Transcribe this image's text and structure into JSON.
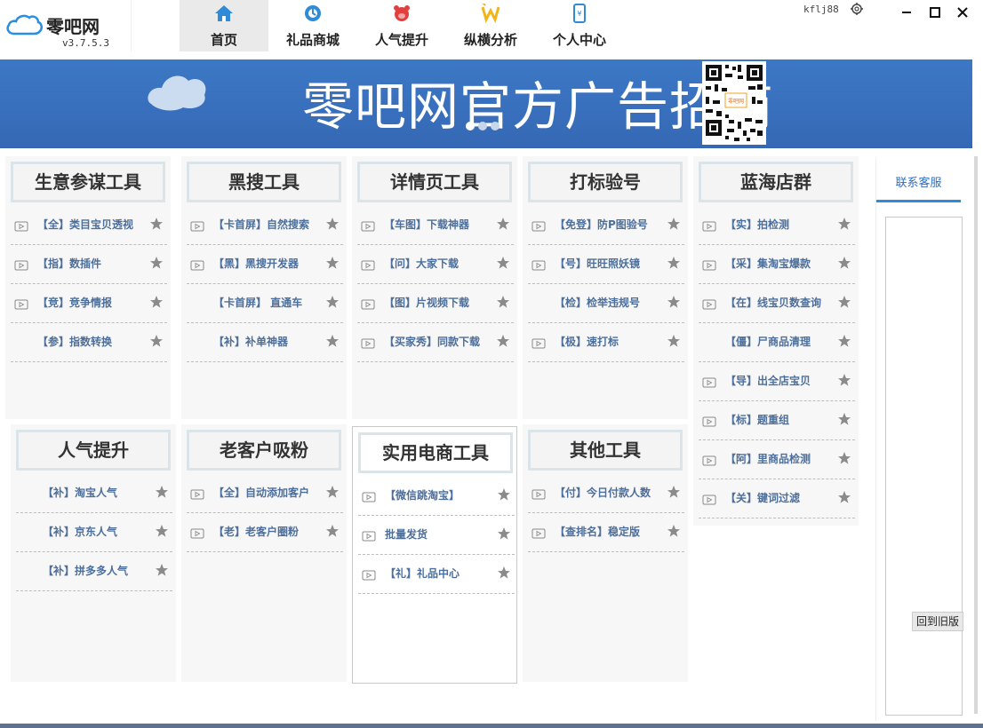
{
  "app": {
    "title": "零吧网",
    "version": "v3.7.5.3",
    "user": "kflj88"
  },
  "nav": [
    {
      "label": "首页",
      "icon": "home-icon",
      "active": true
    },
    {
      "label": "礼品商城",
      "icon": "gift-mall-icon",
      "active": false
    },
    {
      "label": "人气提升",
      "icon": "pig-icon",
      "active": false
    },
    {
      "label": "纵横分析",
      "icon": "analysis-icon",
      "active": false
    },
    {
      "label": "个人中心",
      "icon": "phone-icon",
      "active": false
    }
  ],
  "banner": {
    "text": "零吧网官方广告招商",
    "qr_label": "零吧网"
  },
  "cards": [
    {
      "title": "生意参谋工具",
      "rows": [
        {
          "label": "【全】类目宝贝透视",
          "icon": true
        },
        {
          "label": "【指】数插件",
          "icon": true
        },
        {
          "label": "【竞】竞争情报",
          "icon": true
        },
        {
          "label": "【参】指数转换",
          "icon": false
        }
      ]
    },
    {
      "title": "黑搜工具",
      "rows": [
        {
          "label": "【卡首屏】自然搜索",
          "icon": true
        },
        {
          "label": "【黑】黑搜开发器",
          "icon": true
        },
        {
          "label": "【卡首屏】 直通车",
          "icon": false
        },
        {
          "label": "【补】补单神器",
          "icon": false
        }
      ]
    },
    {
      "title": "详情页工具",
      "rows": [
        {
          "label": "【车图】下载神器",
          "icon": true
        },
        {
          "label": "【问】大家下载",
          "icon": true
        },
        {
          "label": "【图】片视频下载",
          "icon": true
        },
        {
          "label": "【买家秀】同款下载",
          "icon": true
        }
      ]
    },
    {
      "title": "打标验号",
      "rows": [
        {
          "label": "【免登】防P图验号",
          "icon": true
        },
        {
          "label": "【号】旺旺照妖镜",
          "icon": true
        },
        {
          "label": "【检】检举违规号",
          "icon": false
        },
        {
          "label": "【极】速打标",
          "icon": true
        }
      ]
    },
    {
      "title": "蓝海店群",
      "rows": [
        {
          "label": "【实】拍检测",
          "icon": true
        },
        {
          "label": "【采】集淘宝爆款",
          "icon": true
        },
        {
          "label": "【在】线宝贝数查询",
          "icon": true
        },
        {
          "label": "【僵】尸商品清理",
          "icon": false
        },
        {
          "label": "【导】出全店宝贝",
          "icon": true
        },
        {
          "label": "【标】题重组",
          "icon": true
        },
        {
          "label": "【阿】里商品检测",
          "icon": true
        },
        {
          "label": "【关】键词过滤",
          "icon": true
        }
      ]
    },
    {
      "title": "人气提升",
      "rows": [
        {
          "label": "【补】淘宝人气",
          "icon": false
        },
        {
          "label": "【补】京东人气",
          "icon": false
        },
        {
          "label": "【补】拼多多人气",
          "icon": false
        }
      ]
    },
    {
      "title": "老客户吸粉",
      "rows": [
        {
          "label": "【全】自动添加客户",
          "icon": true
        },
        {
          "label": "【老】老客户圈粉",
          "icon": true
        }
      ]
    },
    {
      "title": "实用电商工具",
      "rows": [
        {
          "label": "【微信跳淘宝】",
          "icon": true
        },
        {
          "label": "批量发货",
          "icon": true
        },
        {
          "label": "【礼】礼品中心",
          "icon": true
        }
      ]
    },
    {
      "title": "其他工具",
      "rows": [
        {
          "label": "【付】今日付款人数",
          "icon": true
        },
        {
          "label": "【查排名】稳定版",
          "icon": true
        }
      ]
    }
  ],
  "side": {
    "tab": "联系客服",
    "old_version": "回到旧版"
  },
  "colors": {
    "accent": "#2f8ad8",
    "banner": "#3a72c0",
    "link": "#4d6f9c"
  }
}
